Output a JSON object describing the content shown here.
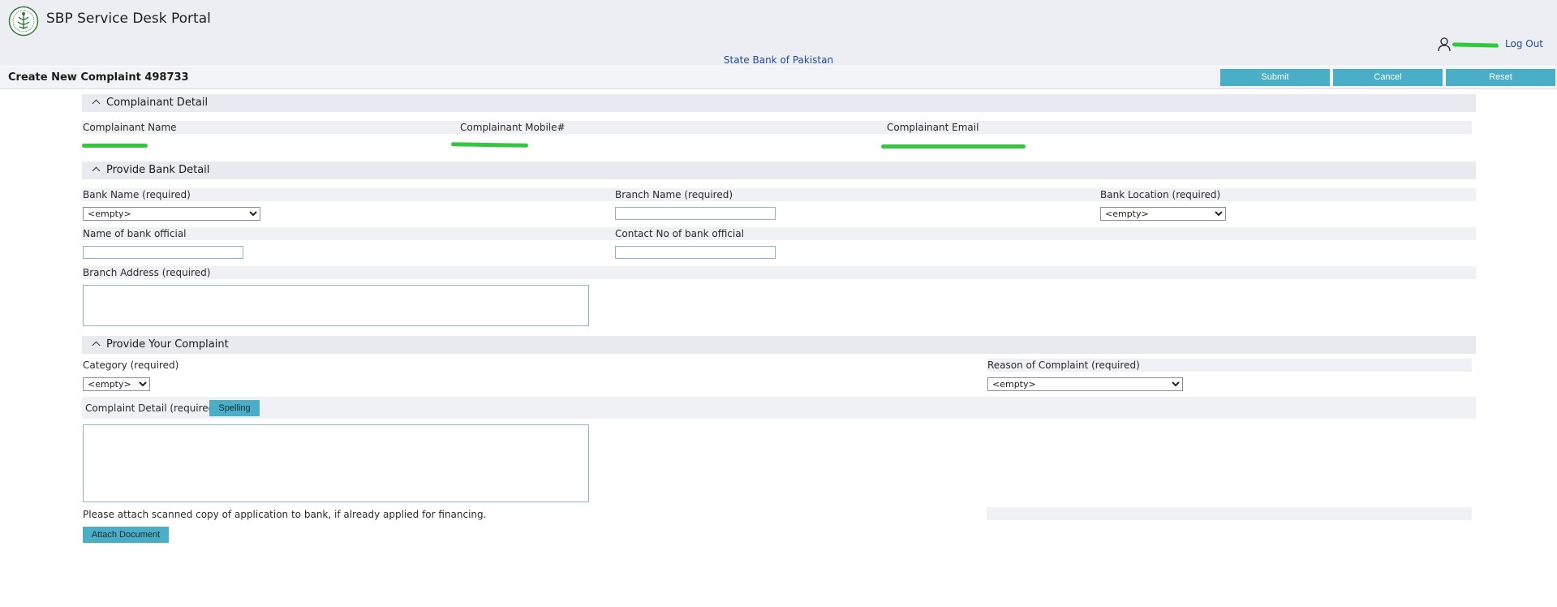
{
  "header": {
    "app_title": "SBP Service Desk Portal",
    "logout_label": "Log Out",
    "org_name": "State Bank of Pakistan"
  },
  "toolbar": {
    "page_title": "Create New Complaint 498733",
    "submit_label": "Submit",
    "cancel_label": "Cancel",
    "reset_label": "Reset"
  },
  "complainant": {
    "section_title": "Complainant Detail",
    "name_label": "Complainant Name",
    "mobile_label": "Complainant Mobile#",
    "email_label": "Complainant Email"
  },
  "bank": {
    "section_title": "Provide Bank Detail",
    "bank_name_label": "Bank Name (required)",
    "bank_name_value": "<empty>",
    "branch_name_label": "Branch Name (required)",
    "bank_location_label": "Bank Location (required)",
    "bank_location_value": "<empty>",
    "official_name_label": "Name of bank official",
    "official_contact_label": "Contact No of bank official",
    "branch_address_label": "Branch Address (required)"
  },
  "complaint": {
    "section_title": "Provide Your Complaint",
    "category_label": "Category (required)",
    "category_value": "<empty>",
    "reason_label": "Reason of Complaint (required)",
    "reason_value": "<empty>",
    "detail_label": "Complaint Detail (required)",
    "spelling_label": "Spelling",
    "attach_note": "Please attach scanned copy of application to bank, if already applied for financing.",
    "attach_label": "Attach Document"
  },
  "colors": {
    "accent_button": "#4aafc6",
    "header_bg": "#eceef3",
    "link_blue": "#1e4c92",
    "redaction_green": "#33c63f"
  },
  "icons": [
    "sbp-logo-icon",
    "user-icon",
    "chevron-up-icon"
  ]
}
